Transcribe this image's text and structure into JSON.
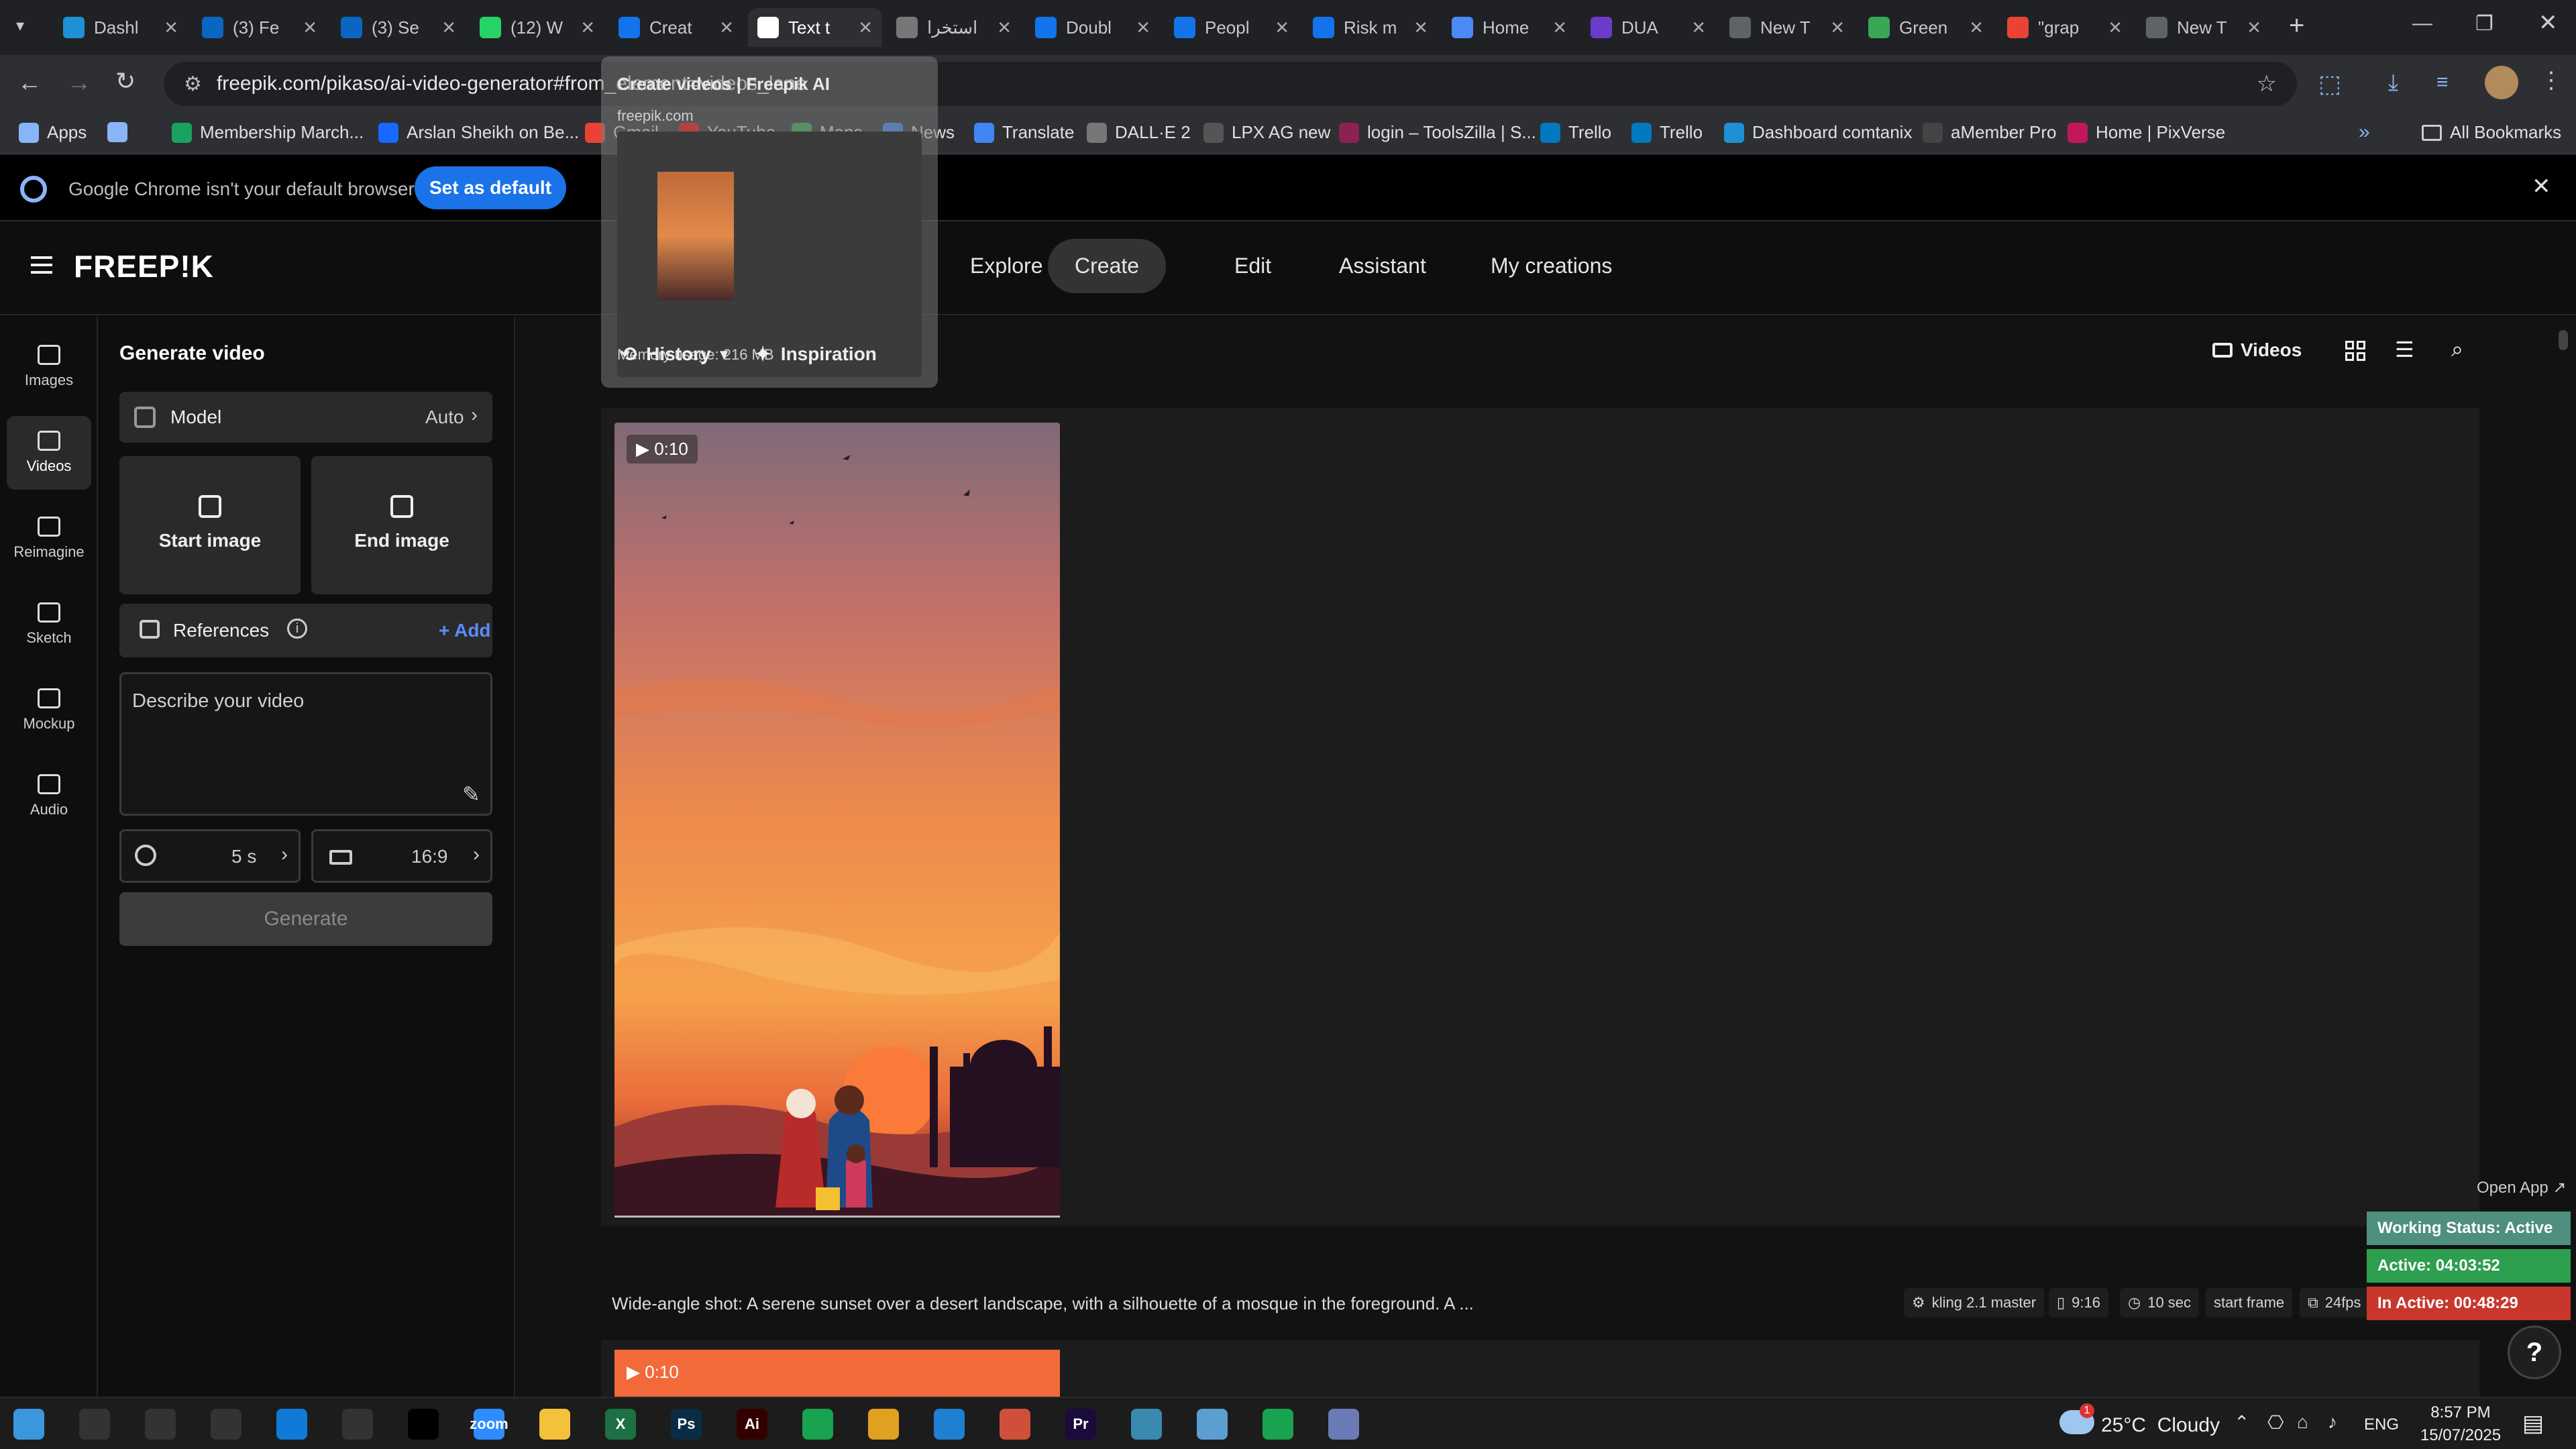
{
  "browser": {
    "tabs": [
      {
        "title": "Dashl",
        "icon": "dashboard-favicon-icon",
        "color": "#1f8fd6"
      },
      {
        "title": "(3) Fe",
        "icon": "linkedin-icon",
        "color": "#0a66c2"
      },
      {
        "title": "(3) Se",
        "icon": "linkedin-icon",
        "color": "#0a66c2"
      },
      {
        "title": "(12) W",
        "icon": "whatsapp-icon",
        "color": "#25d366"
      },
      {
        "title": "Creat",
        "icon": "freepik-favicon-icon",
        "color": "#1273eb"
      },
      {
        "title": "Text t",
        "icon": "pause-favicon-icon",
        "color": "#ffffff",
        "active": true
      },
      {
        "title": "استخرا",
        "icon": "openai-icon",
        "color": "#777777"
      },
      {
        "title": "Doubl",
        "icon": "freepik-favicon-icon",
        "color": "#1273eb"
      },
      {
        "title": "Peopl",
        "icon": "freepik-favicon-icon",
        "color": "#1273eb"
      },
      {
        "title": "Risk m",
        "icon": "freepik-favicon-icon",
        "color": "#1273eb"
      },
      {
        "title": "Home",
        "icon": "home-favicon-icon",
        "color": "#4a8af4"
      },
      {
        "title": "DUA",
        "icon": "video-favicon-icon",
        "color": "#6a3cc9"
      },
      {
        "title": "New T",
        "icon": "chrome-newtab-icon",
        "color": "#5f6368"
      },
      {
        "title": "Green",
        "icon": "palm-favicon-icon",
        "color": "#3aa757"
      },
      {
        "title": "\"grap",
        "icon": "gmail-icon",
        "color": "#ea4335"
      },
      {
        "title": "New T",
        "icon": "chrome-newtab-icon",
        "color": "#5f6368"
      }
    ],
    "url": "freepik.com/pikaso/ai-video-generator#from_element=videos_lane",
    "tab_hover": {
      "title": "Create videos | Freepik AI",
      "domain": "freepik.com",
      "memory": "Memory usage: 216 MB"
    },
    "bookmarks": [
      {
        "label": "Apps",
        "icon": "apps-grid-icon",
        "color": "#8ab4f8"
      },
      {
        "label": "",
        "icon": "microsoft-grid-icon",
        "color": "#8ab4f8"
      },
      {
        "label": "Membership March...",
        "icon": "bookmark-green-icon",
        "color": "#1aa260"
      },
      {
        "label": "Arslan Sheikh on Be...",
        "icon": "behance-icon",
        "color": "#1769ff"
      },
      {
        "label": "Gmail",
        "icon": "gmail-icon",
        "color": "#ea4335"
      },
      {
        "label": "YouTube",
        "icon": "youtube-icon",
        "color": "#ff0000"
      },
      {
        "label": "Maps",
        "icon": "maps-icon",
        "color": "#34a853"
      },
      {
        "label": "News",
        "icon": "news-icon",
        "color": "#4285f4"
      },
      {
        "label": "Translate",
        "icon": "translate-icon",
        "color": "#4285f4"
      },
      {
        "label": "DALL·E 2",
        "icon": "openai-icon",
        "color": "#777777"
      },
      {
        "label": "LPX AG new",
        "icon": "globe-icon",
        "color": "#555555"
      },
      {
        "label": "login – ToolsZilla | S...",
        "icon": "toolszilla-icon",
        "color": "#8b2252"
      },
      {
        "label": "Trello",
        "icon": "trello-icon",
        "color": "#0079bf"
      },
      {
        "label": "Trello",
        "icon": "trello-icon",
        "color": "#0079bf"
      },
      {
        "label": "Dashboard comtanix",
        "icon": "dashboard-favicon-icon",
        "color": "#1f8fd6"
      },
      {
        "label": "aMember Pro",
        "icon": "amember-icon",
        "color": "#444444"
      },
      {
        "label": "Home | PixVerse",
        "icon": "pixverse-icon",
        "color": "#c2185b"
      }
    ],
    "all_bookmarks": "All Bookmarks",
    "default_banner": {
      "text": "Google Chrome isn't your default browser",
      "button": "Set as default"
    }
  },
  "app": {
    "logo": "FREEP!K",
    "nav": [
      "Explore",
      "Create",
      "Edit",
      "Assistant",
      "My creations"
    ],
    "active_nav": "Create",
    "left_nav": [
      {
        "label": "Images",
        "icon": "images-icon"
      },
      {
        "label": "Videos",
        "icon": "videos-icon",
        "selected": true
      },
      {
        "label": "Reimagine",
        "icon": "reimagine-icon"
      },
      {
        "label": "Sketch",
        "icon": "sketch-icon"
      },
      {
        "label": "Mockup",
        "icon": "mockup-icon"
      },
      {
        "label": "Audio",
        "icon": "audio-icon"
      }
    ],
    "panel": {
      "title": "Generate video",
      "model_label": "Model",
      "model_value": "Auto",
      "start_image": "Start image",
      "end_image": "End image",
      "references": "References",
      "add": "+ Add",
      "prompt_placeholder": "Describe your video",
      "duration": "5 s",
      "aspect": "16:9",
      "generate": "Generate"
    },
    "feed_toolbar": {
      "history": "History",
      "inspiration": "Inspiration",
      "videos": "Videos"
    },
    "cards": [
      {
        "duration": "0:10"
      },
      {
        "duration": "0:10"
      }
    ],
    "prompt_preview": "Wide-angle shot: A serene sunset over a desert landscape, with a silhouette of a mosque in the foreground. A ...",
    "tags": [
      "kling 2.1 master",
      "9:16",
      "10 sec",
      "start frame",
      "24fps"
    ],
    "open_app": "Open App ↗",
    "status": [
      {
        "text": "Working Status: Active",
        "color": "#4f8f7f"
      },
      {
        "text": "Active: 04:03:52",
        "color": "#2e9e4f"
      },
      {
        "text": "In Active: 00:48:29",
        "color": "#c8372d"
      }
    ],
    "help": "?"
  },
  "taskbar": {
    "apps": [
      {
        "name": "start-icon",
        "color": "#3a96dd",
        "label": ""
      },
      {
        "name": "search-icon",
        "color": "#333333",
        "label": ""
      },
      {
        "name": "cortana-icon",
        "color": "#333333",
        "label": ""
      },
      {
        "name": "task-view-icon",
        "color": "#333333",
        "label": ""
      },
      {
        "name": "edge-icon",
        "color": "#0f7ad8",
        "label": ""
      },
      {
        "name": "pen-icon",
        "color": "#333333",
        "label": ""
      },
      {
        "name": "terminal-icon",
        "color": "#000000",
        "label": ""
      },
      {
        "name": "zoom-icon",
        "color": "#2d8cff",
        "label": "zoom"
      },
      {
        "name": "file-explorer-icon",
        "color": "#f3c13a",
        "label": ""
      },
      {
        "name": "excel-icon",
        "color": "#1d7044",
        "label": "X"
      },
      {
        "name": "photoshop-icon",
        "color": "#0b2c45",
        "label": "Ps"
      },
      {
        "name": "illustrator-icon",
        "color": "#330000",
        "label": "Ai"
      },
      {
        "name": "phone-link-icon",
        "color": "#19a24f",
        "label": ""
      },
      {
        "name": "chrome-icon",
        "color": "#e0a020",
        "label": ""
      },
      {
        "name": "vscode-icon",
        "color": "#1f7fd0",
        "label": ""
      },
      {
        "name": "chrome-active-icon",
        "color": "#d04f3a",
        "label": ""
      },
      {
        "name": "premiere-icon",
        "color": "#1a0b3a",
        "label": "Pr"
      },
      {
        "name": "app-diamond-icon",
        "color": "#3a8ab0",
        "label": ""
      },
      {
        "name": "app-book-icon",
        "color": "#5a9fd0",
        "label": ""
      },
      {
        "name": "phone-link-icon-2",
        "color": "#19a24f",
        "label": ""
      },
      {
        "name": "calculator-icon",
        "color": "#6b7bb5",
        "label": ""
      }
    ],
    "weather": "25°C  Cloudy",
    "lang": "ENG",
    "time": "8:57 PM",
    "date": "15/07/2025",
    "notif_count": "1"
  }
}
